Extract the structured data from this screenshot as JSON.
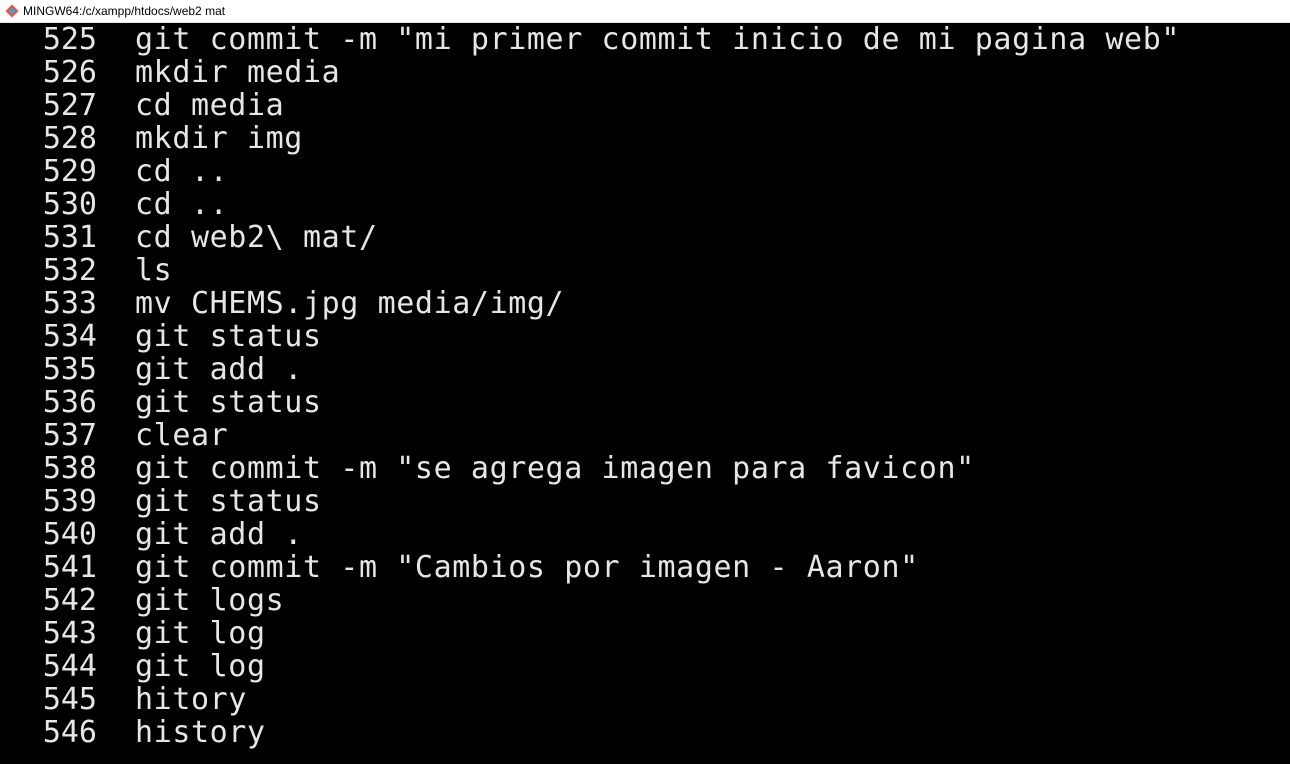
{
  "window": {
    "title": "MINGW64:/c/xampp/htdocs/web2 mat",
    "icon": "git-bash-icon",
    "colors": {
      "background": "#000000",
      "text": "#e6e6e6",
      "icon_red": "#e8523b",
      "icon_teal": "#3aa6d9"
    }
  },
  "history": [
    {
      "num": "525",
      "cmd": "git commit -m \"mi primer commit inicio de mi pagina web\""
    },
    {
      "num": "526",
      "cmd": "mkdir media"
    },
    {
      "num": "527",
      "cmd": "cd media"
    },
    {
      "num": "528",
      "cmd": "mkdir img"
    },
    {
      "num": "529",
      "cmd": "cd .."
    },
    {
      "num": "530",
      "cmd": "cd .."
    },
    {
      "num": "531",
      "cmd": "cd web2\\ mat/"
    },
    {
      "num": "532",
      "cmd": "ls"
    },
    {
      "num": "533",
      "cmd": "mv CHEMS.jpg media/img/"
    },
    {
      "num": "534",
      "cmd": "git status"
    },
    {
      "num": "535",
      "cmd": "git add ."
    },
    {
      "num": "536",
      "cmd": "git status"
    },
    {
      "num": "537",
      "cmd": "clear"
    },
    {
      "num": "538",
      "cmd": "git commit -m \"se agrega imagen para favicon\""
    },
    {
      "num": "539",
      "cmd": "git status"
    },
    {
      "num": "540",
      "cmd": "git add ."
    },
    {
      "num": "541",
      "cmd": "git commit -m \"Cambios por imagen - Aaron\""
    },
    {
      "num": "542",
      "cmd": "git logs"
    },
    {
      "num": "543",
      "cmd": "git log"
    },
    {
      "num": "544",
      "cmd": "git log"
    },
    {
      "num": "545",
      "cmd": "hitory"
    },
    {
      "num": "546",
      "cmd": "history"
    }
  ]
}
